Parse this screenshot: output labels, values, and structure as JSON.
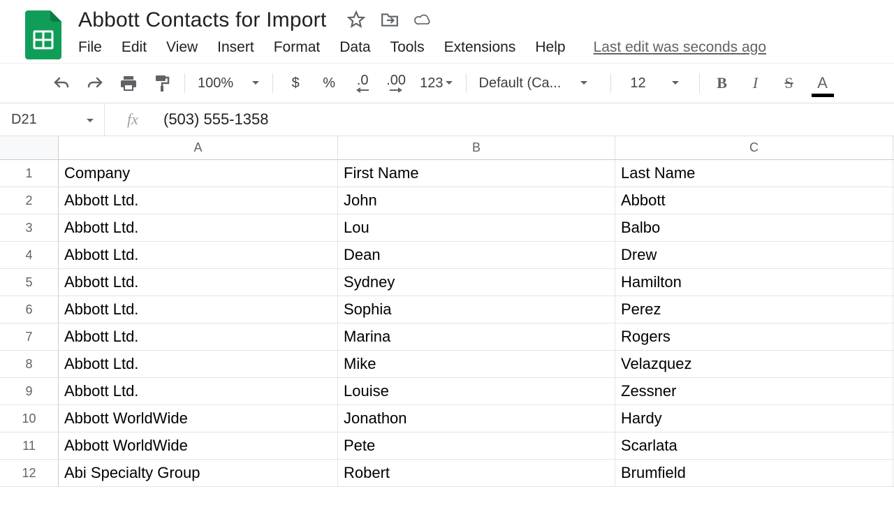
{
  "doc": {
    "title": "Abbott Contacts for Import",
    "last_edit": "Last edit was seconds ago"
  },
  "menu": {
    "file": "File",
    "edit": "Edit",
    "view": "View",
    "insert": "Insert",
    "format": "Format",
    "data": "Data",
    "tools": "Tools",
    "extensions": "Extensions",
    "help": "Help"
  },
  "toolbar": {
    "zoom": "100%",
    "currency": "$",
    "percent": "%",
    "dec_decrease": ".0",
    "dec_increase": ".00",
    "number_format": "123",
    "font": "Default (Ca...",
    "font_size": "12",
    "bold": "B",
    "italic": "I",
    "strike": "S",
    "text_color": "A"
  },
  "formula": {
    "cell_ref": "D21",
    "fx_label": "fx",
    "value": "(503) 555-1358"
  },
  "columns": {
    "a": "A",
    "b": "B",
    "c": "C"
  },
  "rows": {
    "r1": "1",
    "r2": "2",
    "r3": "3",
    "r4": "4",
    "r5": "5",
    "r6": "6",
    "r7": "7",
    "r8": "8",
    "r9": "9",
    "r10": "10",
    "r11": "11",
    "r12": "12"
  },
  "cells": {
    "r1": {
      "a": "Company",
      "b": "First Name",
      "c": "Last Name"
    },
    "r2": {
      "a": "Abbott Ltd.",
      "b": "John",
      "c": "Abbott"
    },
    "r3": {
      "a": "Abbott Ltd.",
      "b": "Lou",
      "c": "Balbo"
    },
    "r4": {
      "a": "Abbott Ltd.",
      "b": "Dean",
      "c": "Drew"
    },
    "r5": {
      "a": "Abbott Ltd.",
      "b": "Sydney",
      "c": "Hamilton"
    },
    "r6": {
      "a": "Abbott Ltd.",
      "b": "Sophia",
      "c": "Perez"
    },
    "r7": {
      "a": "Abbott Ltd.",
      "b": "Marina",
      "c": "Rogers"
    },
    "r8": {
      "a": "Abbott Ltd.",
      "b": "Mike",
      "c": "Velazquez"
    },
    "r9": {
      "a": "Abbott Ltd.",
      "b": "Louise",
      "c": "Zessner"
    },
    "r10": {
      "a": "Abbott WorldWide",
      "b": "Jonathon",
      "c": "Hardy"
    },
    "r11": {
      "a": "Abbott WorldWide",
      "b": "Pete",
      "c": "Scarlata"
    },
    "r12": {
      "a": "Abi Specialty Group",
      "b": "Robert",
      "c": "Brumfield"
    }
  }
}
